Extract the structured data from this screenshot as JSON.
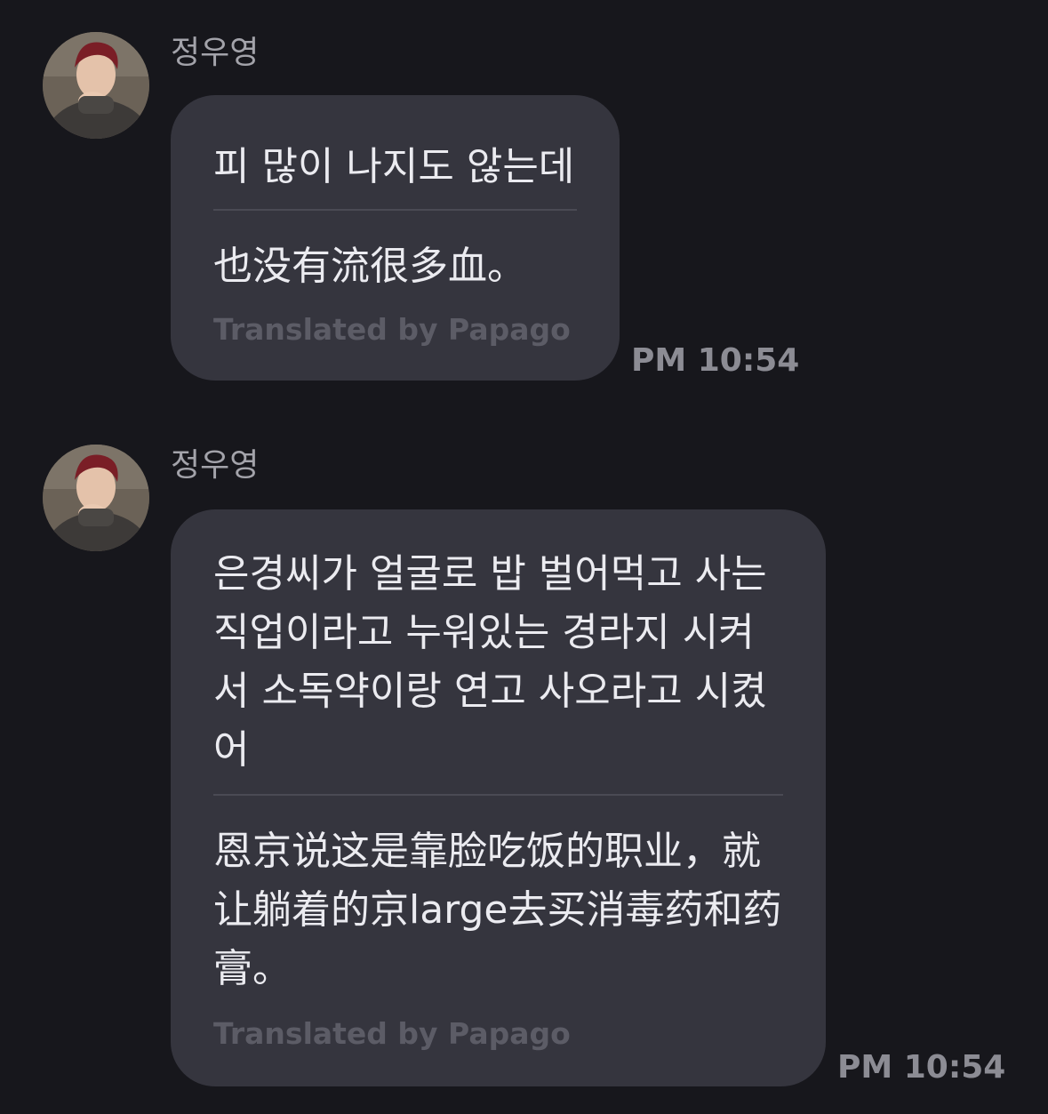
{
  "messages": [
    {
      "sender": "정우영",
      "original": "피 많이 나지도 않는데",
      "translation": "也没有流很多血。",
      "credit": "Translated by Papago",
      "time": "PM 10:54"
    },
    {
      "sender": "정우영",
      "original": "은경씨가 얼굴로 밥 벌어먹고 사는 직업이라고 누워있는 경라지 시켜서 소독약이랑 연고 사오라고 시켰어",
      "translation": "恩京说这是靠脸吃饭的职业，就让躺着的京large去买消毒药和药膏。",
      "credit": "Translated by Papago",
      "time": "PM 10:54"
    }
  ],
  "colors": {
    "background": "#17171c",
    "bubble": "#35353e",
    "text": "#ebebf0",
    "credit": "#5c5c66",
    "time": "#8c8c94"
  },
  "icons": {
    "avatar": "profile-photo"
  }
}
